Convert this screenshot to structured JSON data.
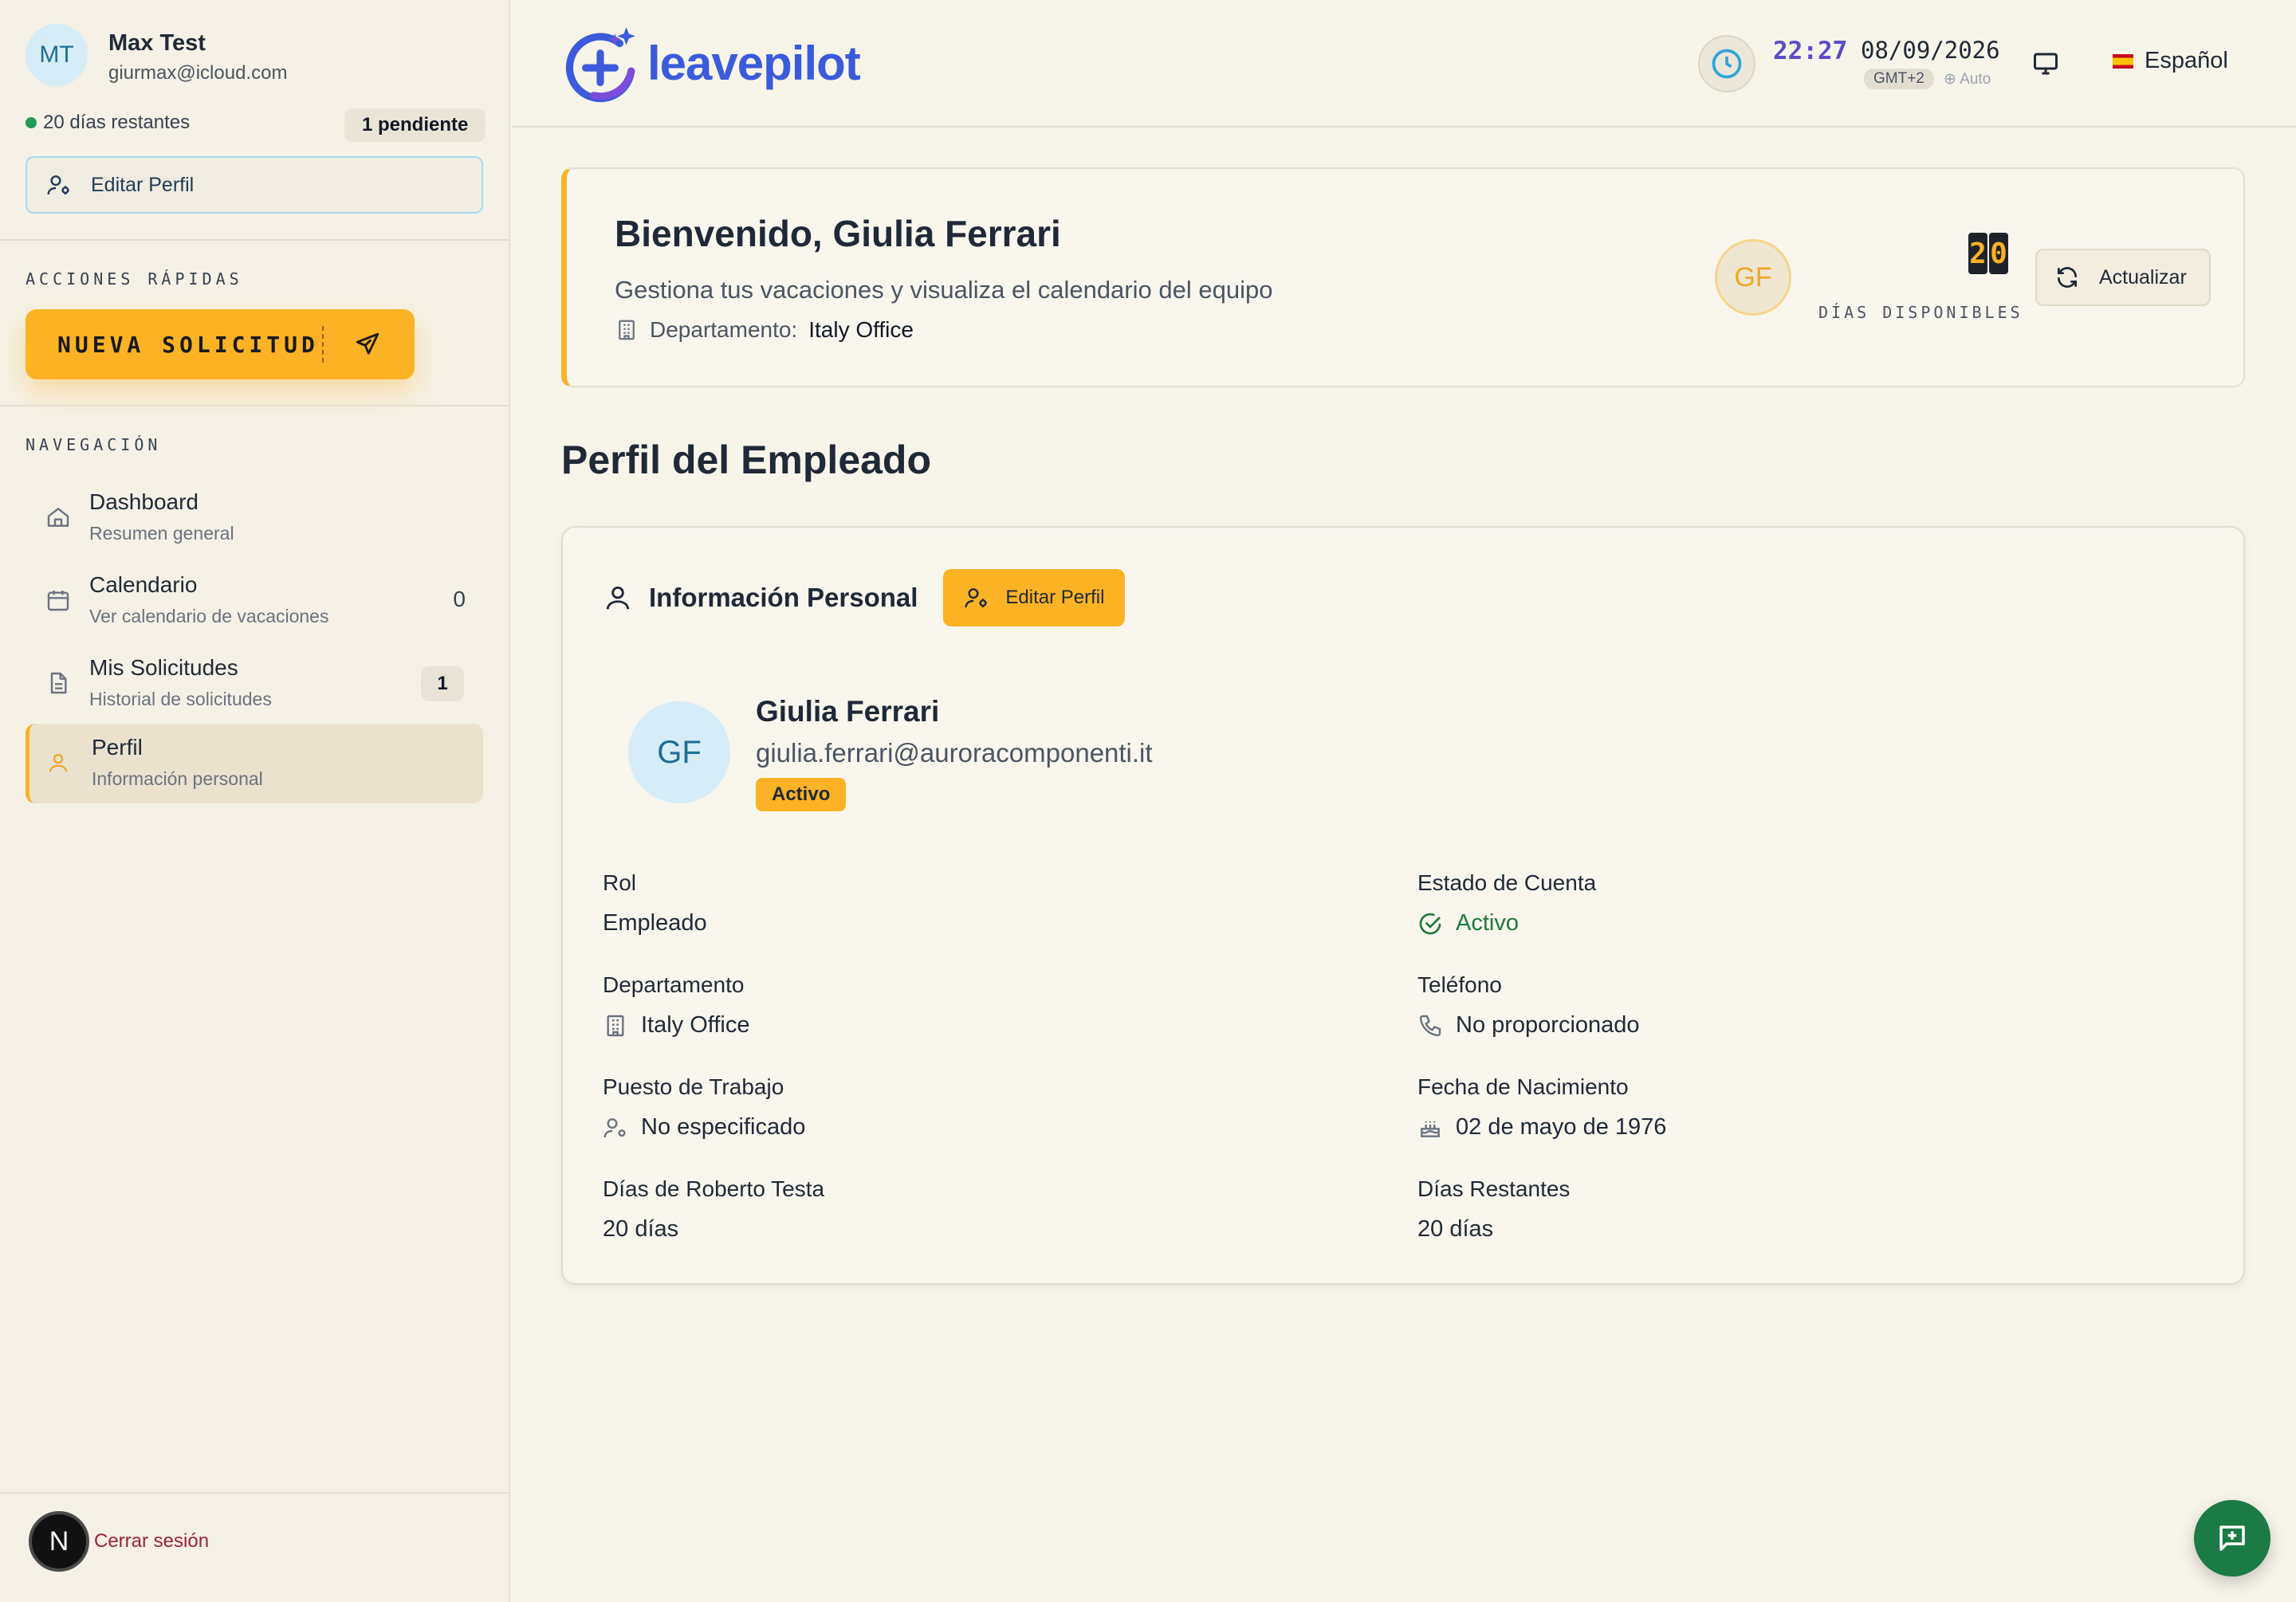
{
  "user": {
    "initials": "MT",
    "name": "Max Test",
    "email": "giurmax@icloud.com",
    "days_left": "20 días restantes",
    "pending": "1 pendiente",
    "edit_profile": "Editar Perfil"
  },
  "quick_actions": {
    "label": "ACCIONES RÁPIDAS",
    "new_request": "NUEVA SOLICITUD"
  },
  "navigation": {
    "label": "NAVEGACIÓN",
    "items": [
      {
        "title": "Dashboard",
        "subtitle": "Resumen general",
        "icon": "home-icon"
      },
      {
        "title": "Calendario",
        "subtitle": "Ver calendario de vacaciones",
        "count": "0",
        "icon": "calendar-icon"
      },
      {
        "title": "Mis Solicitudes",
        "subtitle": "Historial de solicitudes",
        "badge": "1",
        "icon": "document-icon"
      },
      {
        "title": "Perfil",
        "subtitle": "Información personal",
        "icon": "user-icon",
        "active": true
      }
    ]
  },
  "logout": {
    "avatar": "N",
    "label": "Cerrar sesión"
  },
  "header": {
    "logo": "leavepilot",
    "time": "22:27",
    "date": "08/09/2026",
    "timezone": "GMT+2",
    "tz_mode": "⊕ Auto",
    "language": "Español"
  },
  "welcome": {
    "title": "Bienvenido, Giulia Ferrari",
    "subtitle": "Gestiona tus vacaciones y visualiza el calendario del equipo",
    "dept_label": "Departamento:",
    "dept_value": "Italy Office",
    "initials": "GF",
    "days_digits": [
      "2",
      "0"
    ],
    "days_label": "DÍAS DISPONIBLES",
    "refresh": "Actualizar"
  },
  "page_title": "Perfil del Empleado",
  "profile": {
    "section_title": "Información Personal",
    "edit_button": "Editar Perfil",
    "initials": "GF",
    "name": "Giulia Ferrari",
    "email": "giulia.ferrari@auroracomponenti.it",
    "status_badge": "Activo",
    "fields": {
      "role_label": "Rol",
      "role_value": "Empleado",
      "account_label": "Estado de Cuenta",
      "account_value": "Activo",
      "dept_label": "Departamento",
      "dept_value": "Italy Office",
      "phone_label": "Teléfono",
      "phone_value": "No proporcionado",
      "job_label": "Puesto de Trabajo",
      "job_value": "No especificado",
      "birth_label": "Fecha de Nacimiento",
      "birth_value": "02 de mayo de 1976",
      "days_label": "Días de Roberto Testa",
      "days_value": "20 días",
      "remaining_label": "Días Restantes",
      "remaining_value": "20 días"
    }
  },
  "colors": {
    "accent": "#fbb224",
    "brand": "#3b5bdb",
    "success": "#1f7a3a",
    "fab": "#1b7a45"
  }
}
